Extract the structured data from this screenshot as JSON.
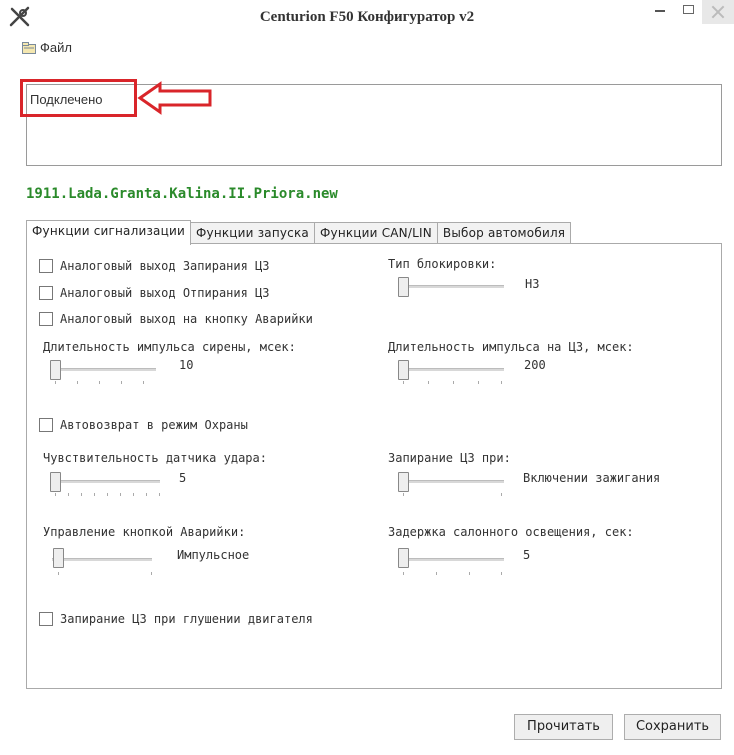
{
  "window": {
    "title": "Centurion F50 Конфигуратор v2"
  },
  "menu": {
    "file": "Файл"
  },
  "log": {
    "text": "Подклечено"
  },
  "profile": {
    "name": "1911.Lada.Granta.Kalina.II.Priora.new"
  },
  "tabs": [
    {
      "label": "Функции сигнализации",
      "active": true
    },
    {
      "label": "Функции запуска",
      "active": false
    },
    {
      "label": "Функции CAN/LIN",
      "active": false
    },
    {
      "label": "Выбор автомобиля",
      "active": false
    }
  ],
  "checkboxes": {
    "lock_output": {
      "label": "Аналоговый выход Запирания ЦЗ",
      "checked": false
    },
    "unlock_output": {
      "label": "Аналоговый выход Отпирания ЦЗ",
      "checked": false
    },
    "hazard_output": {
      "label": "Аналоговый выход на кнопку Аварийки",
      "checked": false
    },
    "auto_rearm": {
      "label": "Автовозврат в режим Охраны",
      "checked": false
    },
    "lock_engine_off": {
      "label": "Запирание ЦЗ при глушении двигателя",
      "checked": false
    }
  },
  "settings": {
    "block_type": {
      "label": "Тип блокировки:",
      "value": "НЗ",
      "position": 0
    },
    "siren_pulse": {
      "label": "Длительность импульса сирены, мсек:",
      "value": "10",
      "position": 0
    },
    "lock_pulse": {
      "label": "Длительность импульса на ЦЗ, мсек:",
      "value": "200",
      "position": 0
    },
    "shock_sensitivity": {
      "label": "Чувствительность датчика удара:",
      "value": "5",
      "position": 0
    },
    "lock_on": {
      "label": "Запирание ЦЗ при:",
      "value": "Включении зажигания",
      "position": 0
    },
    "hazard_control": {
      "label": "Управление кнопкой Аварийки:",
      "value": "Импульсное",
      "position": 0
    },
    "light_delay": {
      "label": "Задержка салонного освещения, сек:",
      "value": "5",
      "position": 0
    }
  },
  "buttons": {
    "read": "Прочитать",
    "save": "Сохранить"
  },
  "colors": {
    "highlight": "#d9252a",
    "profile_text": "#2a8a2a"
  }
}
